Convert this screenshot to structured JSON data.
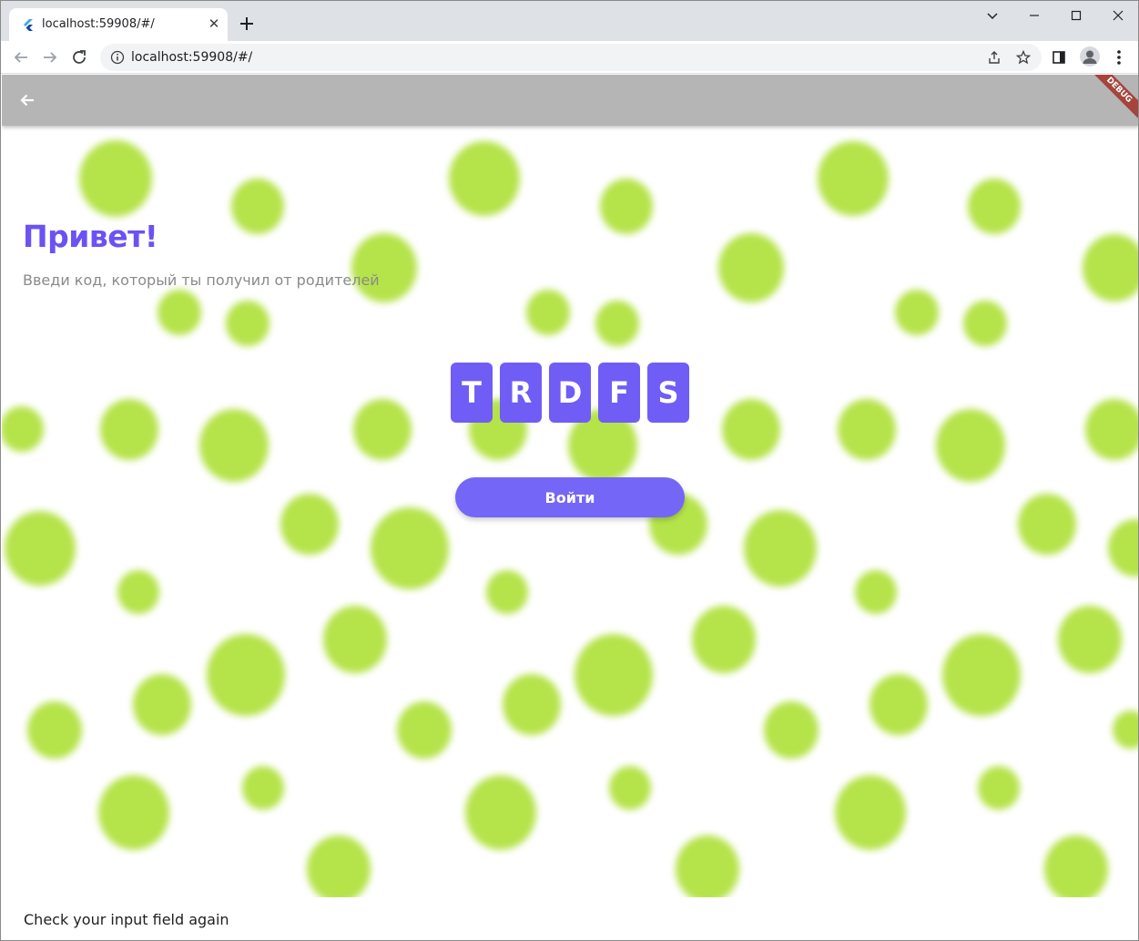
{
  "browser": {
    "tab_title": "localhost:59908/#/",
    "tab_close_glyph": "✕",
    "url": "localhost:59908/#/",
    "icons": [
      "flutter-favicon-icon",
      "close-icon",
      "plus-icon",
      "chevron-down-icon",
      "minimize-icon",
      "maximize-icon",
      "close-window-icon",
      "back-arrow-icon",
      "forward-arrow-icon",
      "reload-icon",
      "info-icon",
      "share-icon",
      "star-icon",
      "side-panel-icon",
      "profile-icon",
      "kebab-menu-icon"
    ]
  },
  "app": {
    "appbar_color": "#b5b5b5",
    "debug_label": "DEBUG",
    "title": "Привет!",
    "subtitle": "Введи код, который ты получил от родителей",
    "code": [
      "T",
      "R",
      "D",
      "F",
      "S"
    ],
    "login_label": "Войти",
    "snackbar_message": "Check your input field again",
    "colors": {
      "accent": "#6b52f5",
      "code_box": "#6f5df6",
      "button": "#7466f7",
      "blob": "#b5e34a"
    }
  }
}
